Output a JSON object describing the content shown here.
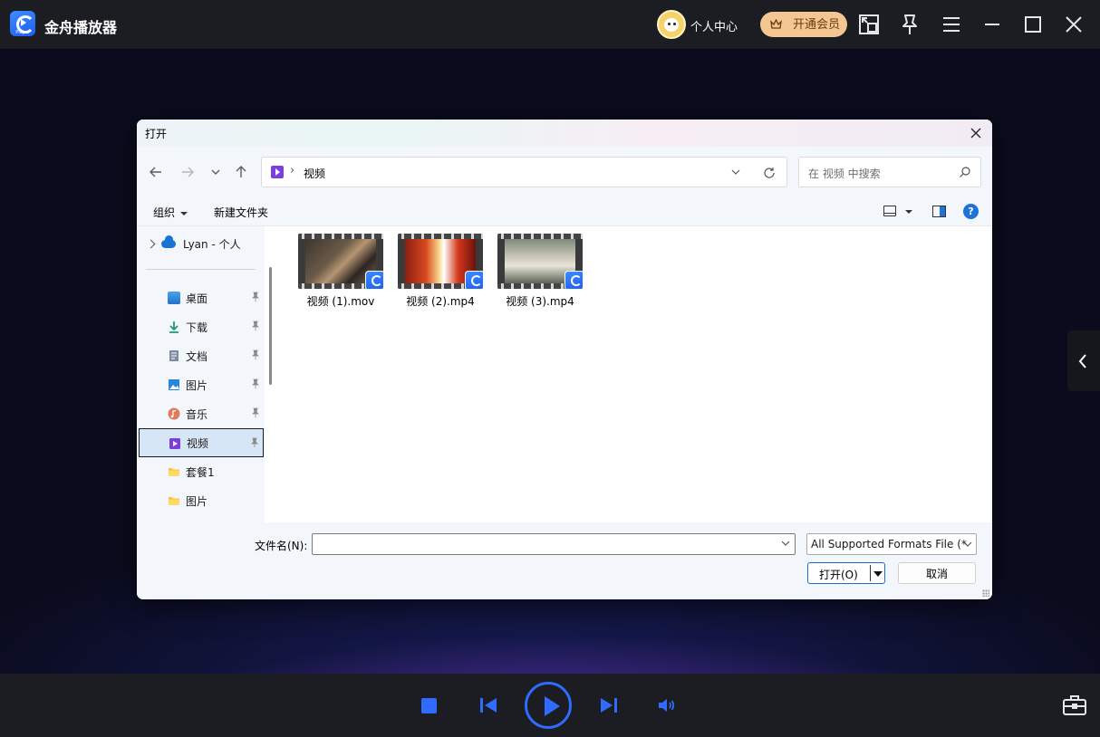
{
  "app": {
    "title": "金舟播放器",
    "logo_sub": "Player",
    "user_center": "个人中心",
    "vip_button": "开通会员"
  },
  "dialog": {
    "title": "打开",
    "address": {
      "separator": "›",
      "current": "视频"
    },
    "search_placeholder": "在 视频 中搜索",
    "toolbar": {
      "organize": "组织",
      "new_folder": "新建文件夹",
      "help": "?"
    },
    "nav": {
      "onedrive": "Lyan - 个人",
      "items": [
        {
          "label": "桌面",
          "icon": "desktop-icon",
          "pinned": true
        },
        {
          "label": "下载",
          "icon": "download-icon",
          "pinned": true
        },
        {
          "label": "文档",
          "icon": "document-icon",
          "pinned": true
        },
        {
          "label": "图片",
          "icon": "pictures-icon",
          "pinned": true
        },
        {
          "label": "音乐",
          "icon": "music-icon",
          "pinned": true
        },
        {
          "label": "视频",
          "icon": "videos-icon",
          "pinned": true,
          "selected": true
        },
        {
          "label": "套餐1",
          "icon": "folder-icon",
          "pinned": false
        },
        {
          "label": "图片",
          "icon": "folder-icon",
          "pinned": false
        }
      ]
    },
    "files": [
      {
        "name": "视频 (1).mov"
      },
      {
        "name": "视频 (2).mp4"
      },
      {
        "name": "视频 (3).mp4"
      }
    ],
    "filename_label": "文件名(N):",
    "filename_value": "",
    "filter": "All Supported Formats File (*",
    "open_button": "打开(O)",
    "cancel_button": "取消"
  },
  "colors": {
    "accent": "#2f6bff",
    "vip": "#f3c692",
    "selected_nav": "#d7e6f6",
    "videos_folder": "#7b3fe0"
  }
}
